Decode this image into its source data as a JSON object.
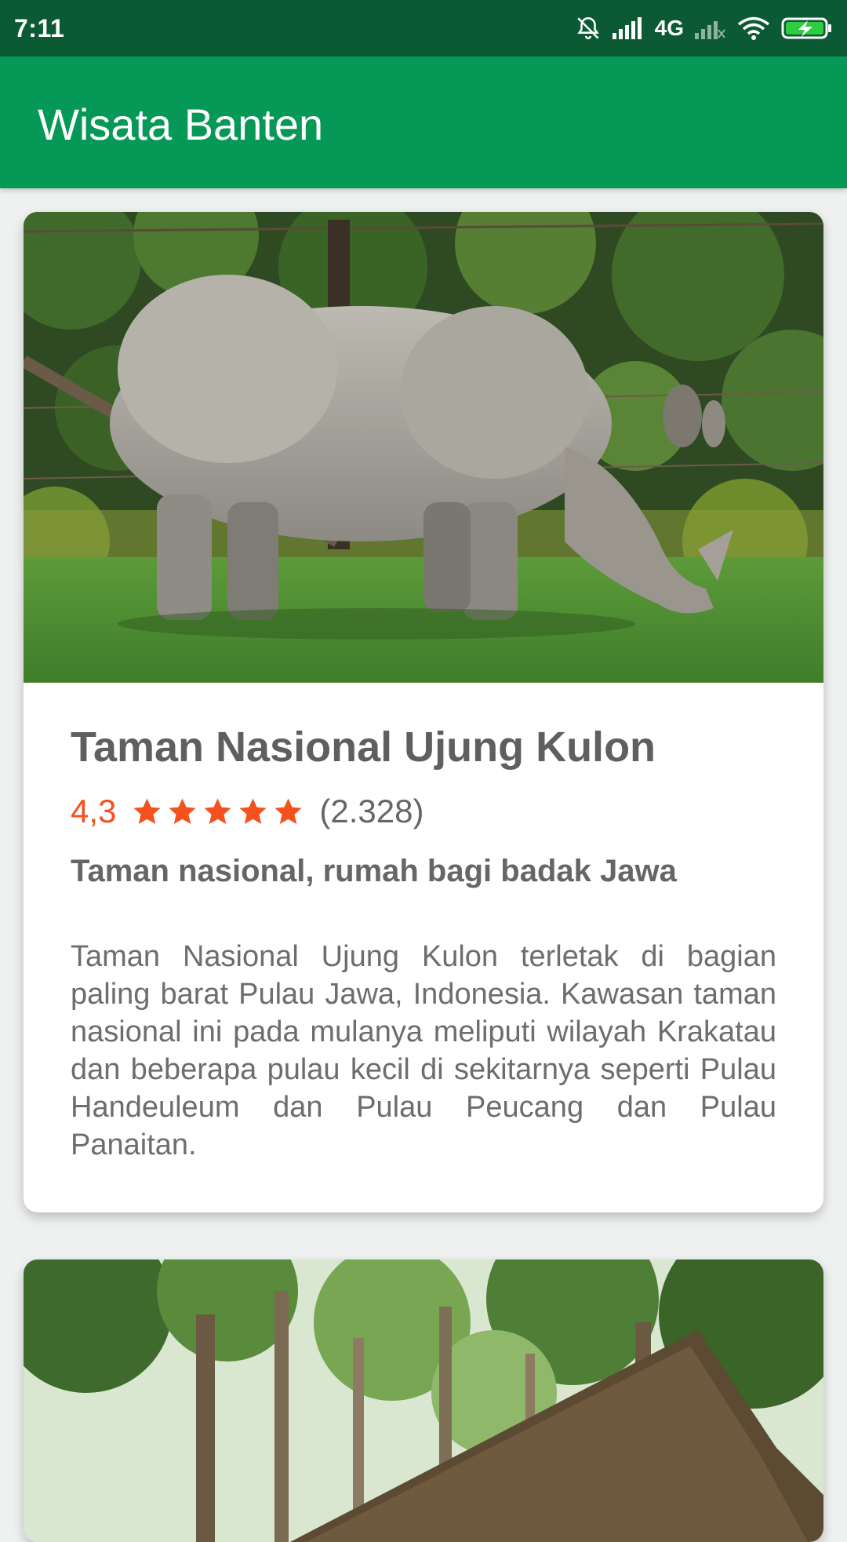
{
  "status_bar": {
    "time": "7:11",
    "network_label": "4G",
    "icons": [
      "bell-off-icon",
      "signal-icon",
      "signal-weak-icon",
      "wifi-icon",
      "battery-charging-icon"
    ]
  },
  "app_bar": {
    "title": "Wisata Banten"
  },
  "places": [
    {
      "name": "Taman Nasional Ujung Kulon",
      "rating": "4,3",
      "rating_stars": 5,
      "review_count": "(2.328)",
      "tagline": "Taman nasional, rumah bagi badak Jawa",
      "description": "Taman Nasional Ujung Kulon terletak di bagian paling barat Pulau Jawa, Indonesia. Kawasan taman nasional ini pada mulanya meliputi wilayah Krakatau dan beberapa pulau kecil di sekitarnya seperti Pulau Handeuleum dan Pulau Peucang dan Pulau Panaitan."
    }
  ],
  "colors": {
    "status_bar": "#0b5a33",
    "app_bar": "#069856",
    "rating_accent": "#f4511e",
    "background": "#eef1ef"
  }
}
